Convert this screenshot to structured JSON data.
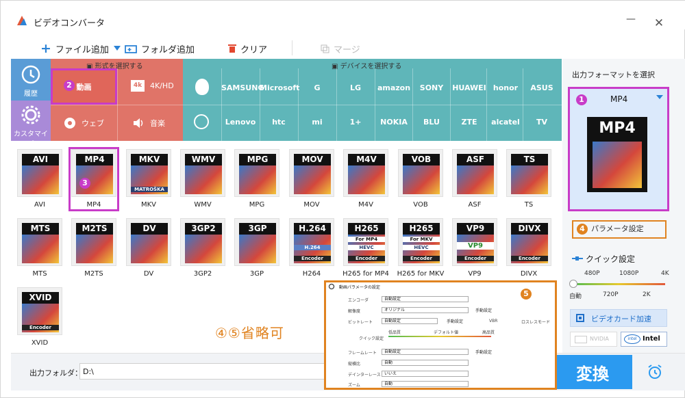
{
  "window": {
    "title": "ビデオコンバータ",
    "minimize": "—",
    "close": "✕"
  },
  "toolbar": {
    "add_file": "ファイル追加",
    "add_folder": "フォルダ追加",
    "clear": "クリア",
    "merge": "マージ"
  },
  "categories": {
    "history_label": "履歴",
    "custom_label": "カスタマイズ",
    "format_header": "形式を選択する",
    "device_header": "デバイスを選択する",
    "format_buttons": [
      "動画",
      "4K/HD",
      "ウェブ",
      "音楽"
    ],
    "brands_row1": [
      "",
      "SAMSUNG",
      "Microsoft",
      "G",
      "LG",
      "amazon",
      "SONY",
      "HUAWEI",
      "honor",
      "ASUS"
    ],
    "brands_row2": [
      "",
      "Lenovo",
      "htc",
      "mi",
      "1+",
      "NOKIA",
      "BLU",
      "ZTE",
      "alcatel",
      "TV"
    ]
  },
  "formats": [
    {
      "label": "AVI",
      "top": "AVI"
    },
    {
      "label": "MP4",
      "top": "MP4"
    },
    {
      "label": "MKV",
      "top": "MKV"
    },
    {
      "label": "WMV",
      "top": "WMV"
    },
    {
      "label": "MPG",
      "top": "MPG"
    },
    {
      "label": "MOV",
      "top": "MOV"
    },
    {
      "label": "M4V",
      "top": "M4V"
    },
    {
      "label": "VOB",
      "top": "VOB"
    },
    {
      "label": "ASF",
      "top": "ASF"
    },
    {
      "label": "TS",
      "top": "TS"
    },
    {
      "label": "MTS",
      "top": "MTS"
    },
    {
      "label": "M2TS",
      "top": "M2TS"
    },
    {
      "label": "DV",
      "top": "DV"
    },
    {
      "label": "3GP2",
      "top": "3GP2"
    },
    {
      "label": "3GP",
      "top": "3GP"
    },
    {
      "label": "H264",
      "top": "H.264"
    },
    {
      "label": "H265 for MP4",
      "top": "H265"
    },
    {
      "label": "H265 for MKV",
      "top": "H265"
    },
    {
      "label": "VP9",
      "top": "VP9"
    },
    {
      "label": "DIVX",
      "top": "DIVX"
    },
    {
      "label": "XVID",
      "top": "XVID"
    }
  ],
  "format_sub": {
    "mkv": "MATROŠKA",
    "h264_mid": "H.264",
    "h265mp4_mid": "For MP4",
    "h265mkv_mid": "For MKV",
    "hevc": "HEVC",
    "encoder": "Encoder",
    "vp9": "VP9"
  },
  "right_panel": {
    "title": "出力フォーマットを選択",
    "selected_format": "MP4",
    "preview_text": "MP4",
    "param_button": "パラメータ設定",
    "quick_settings": "クイック設定",
    "ticks_top": [
      "480P",
      "1080P",
      "4K"
    ],
    "ticks_bottom": [
      "自動",
      "720P",
      "2K"
    ],
    "gpu_button": "ビデオカード加速",
    "nvidia": "NVIDIA",
    "intel": "Intel"
  },
  "bottom": {
    "output_folder_label": "出力フォルダ：",
    "output_folder_value": "D:\\",
    "convert": "変換"
  },
  "badges": [
    "1",
    "2",
    "3",
    "4",
    "5"
  ],
  "overlay": {
    "title": "動画パラメータの設定",
    "encoder_label": "エンコーダ",
    "encoder_value": "自動設定",
    "resolution_label": "解像度",
    "resolution_value": "オリジナル",
    "manual": "手動設定",
    "bitrate_label": "ビットレート",
    "bitrate_value": "自動設定",
    "vbr": "VBR",
    "lossless": "ロスレスモード",
    "quick_label": "クイック設定",
    "low": "低品質",
    "default": "デフォルト値",
    "high": "高品質",
    "framerate_label": "フレームレート",
    "framerate_value": "自動設定",
    "aspect_label": "縦横比",
    "aspect_value": "自動",
    "deinterlace_label": "デインターレース",
    "deinterlace_value": "いいえ",
    "zoom_label": "ズーム",
    "zoom_value": "自動"
  },
  "annotation": "④⑤省略可",
  "colors": {
    "highlight": "#c83cc8",
    "orange": "#e08320",
    "format_red": "#e07468",
    "device_teal": "#5fb6b9",
    "accent_blue": "#2b9af0"
  }
}
